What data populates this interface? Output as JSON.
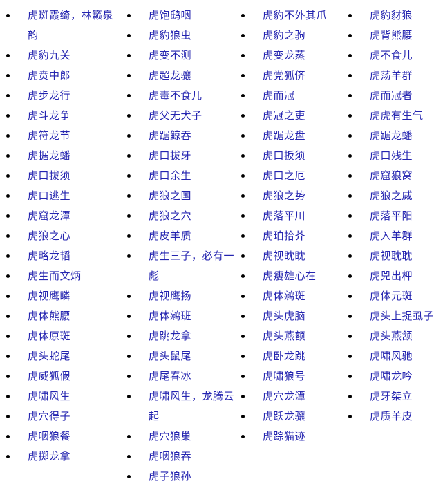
{
  "page": {
    "title": "虎字成语列表",
    "text_color": "#2525b0",
    "bullet_color": "#000000",
    "background_color": "#ffffff",
    "layout": "four-column bulleted list"
  },
  "columns": [
    {
      "name": "column-1",
      "items": [
        "虎斑霞绮，林籁泉韵",
        "虎豹九关",
        "虎贲中郎",
        "虎步龙行",
        "虎斗龙争",
        "虎符龙节",
        "虎据龙蟠",
        "虎口拔须",
        "虎口逃生",
        "虎窟龙潭",
        "虎狼之心",
        "虎略龙韬",
        "虎生而文炳",
        "虎视鹰瞵",
        "虎体熊腰",
        "虎体原斑",
        "虎头蛇尾",
        "虎威狐假",
        "虎啸风生",
        "虎穴得子",
        "虎咽狼餐",
        "虎掷龙拿"
      ]
    },
    {
      "name": "column-2",
      "items": [
        "虎饱鸱咽",
        "虎豹狼虫",
        "虎变不测",
        "虎超龙骧",
        "虎毒不食儿",
        "虎父无犬子",
        "虎踞鲸吞",
        "虎口拔牙",
        "虎口余生",
        "虎狼之国",
        "虎狼之穴",
        "虎皮羊质",
        "虎生三子，必有一彪",
        "虎视鹰扬",
        "虎体鹓班",
        "虎跳龙拿",
        "虎头鼠尾",
        "虎尾春冰",
        "虎啸风生，龙腾云起",
        "虎穴狼巢",
        "虎咽狼吞",
        "虎子狼孙"
      ]
    },
    {
      "name": "column-3",
      "items": [
        "虎豹不外其爪",
        "虎豹之驹",
        "虎变龙蒸",
        "虎党狐侪",
        "虎而冠",
        "虎冠之吏",
        "虎踞龙盘",
        "虎口扳须",
        "虎口之厄",
        "虎狼之势",
        "虎落平川",
        "虎珀拾芥",
        "虎视眈眈",
        "虎瘦雄心在",
        "虎体鹓斑",
        "虎头虎脑",
        "虎头燕额",
        "虎卧龙跳",
        "虎啸狼号",
        "虎穴龙潭",
        "虎跃龙骧",
        "虎踪猫迹"
      ]
    },
    {
      "name": "column-4",
      "items": [
        "虎豹豺狼",
        "虎背熊腰",
        "虎不食儿",
        "虎荡羊群",
        "虎而冠者",
        "虎虎有生气",
        "虎踞龙蟠",
        "虎口残生",
        "虎窟狼窝",
        "虎狼之威",
        "虎落平阳",
        "虎入羊群",
        "虎视耽耽",
        "虎兕出柙",
        "虎体元斑",
        "虎头上捉虱子",
        "虎头燕颔",
        "虎啸风驰",
        "虎啸龙吟",
        "虎牙桀立",
        "虎质羊皮"
      ]
    }
  ]
}
